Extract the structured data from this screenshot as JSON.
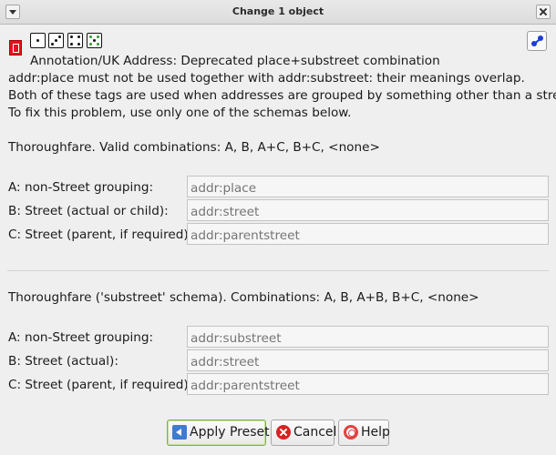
{
  "window": {
    "title": "Change 1 object"
  },
  "icons": {
    "josm": "josm-file-icon",
    "dice": [
      "dice-one-icon",
      "dice-three-icon",
      "dice-four-icon",
      "dice-five-icon"
    ],
    "preset": "node-preset-icon"
  },
  "description": {
    "heading": "Annotation/UK Address: Deprecated place+substreet combination",
    "line1": "addr:place must not be used together with addr:substreet: their meanings overlap.",
    "line2": "Both of these tags are used when addresses are grouped by something other than a street.",
    "line3": "To fix this problem, use only one of the schemas below."
  },
  "section1": {
    "heading": "Thoroughfare. Valid combinations: A, B, A+C, B+C, <none>",
    "rows": [
      {
        "label": "A: non-Street grouping:",
        "placeholder": "addr:place"
      },
      {
        "label": "B: Street (actual or child):",
        "placeholder": "addr:street"
      },
      {
        "label": "C: Street (parent, if required):",
        "placeholder": "addr:parentstreet"
      }
    ]
  },
  "section2": {
    "heading": "Thoroughfare ('substreet' schema). Combinations: A, B, A+B, B+C, <none>",
    "rows": [
      {
        "label": "A: non-Street grouping:",
        "placeholder": "addr:substreet"
      },
      {
        "label": "B: Street (actual):",
        "placeholder": "addr:street"
      },
      {
        "label": "C: Street (parent, if required):",
        "placeholder": "addr:parentstreet"
      }
    ]
  },
  "buttons": {
    "apply": "Apply Preset",
    "cancel": "Cancel",
    "help": "Help"
  },
  "colors": {
    "josm_red": "#e8101d",
    "apply_border": "#80b24c",
    "cancel_red": "#d92121"
  }
}
